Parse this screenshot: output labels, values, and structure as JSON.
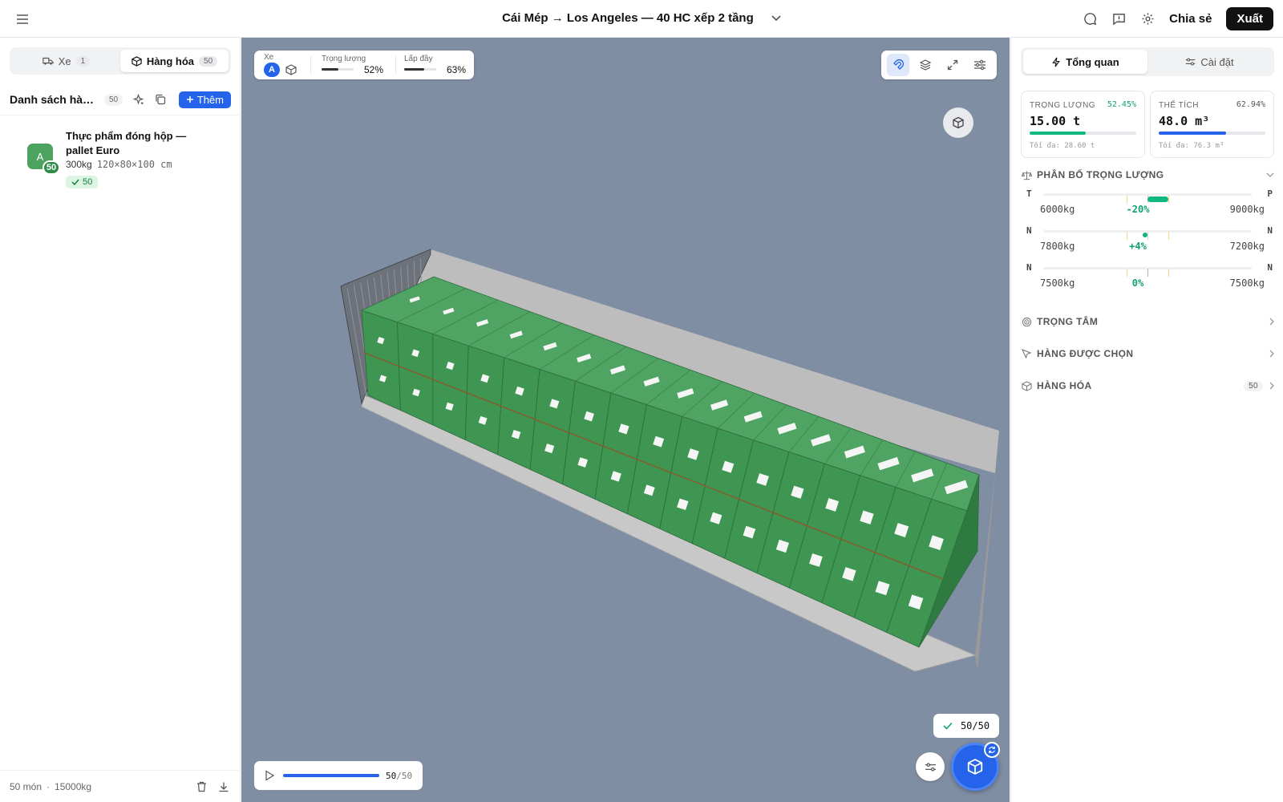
{
  "header": {
    "title": "Cái Mép → Los Angeles — 40 HC xếp 2 tầng",
    "share_label": "Chia sẻ",
    "export_label": "Xuất"
  },
  "left": {
    "tabs": [
      {
        "label": "Xe",
        "count": "1"
      },
      {
        "label": "Hàng hóa",
        "count": "50"
      }
    ],
    "list_title": "Danh sách hàng hóa",
    "list_count": "50",
    "add_label": "Thêm",
    "items": [
      {
        "letter": "A",
        "count": "50",
        "name": "Thực phẩm đóng hộp — pallet Euro",
        "weight": "300kg",
        "dims": "120×80×100 cm",
        "placed": "50"
      }
    ],
    "footer": {
      "items": "50 món",
      "sep": "·",
      "weight": "15000kg"
    }
  },
  "viewport": {
    "stats": {
      "vehicle_label": "Xe",
      "vehicle_letter": "A",
      "weight_label": "Trọng lượng",
      "weight_pct": "52%",
      "weight_fraction": 0.52,
      "fill_label": "Lấp đầy",
      "fill_pct": "63%",
      "fill_fraction": 0.63
    },
    "progress_label": "50/50",
    "playback": {
      "current": "50",
      "total": "/50"
    },
    "colors": {
      "box": "#3f9552",
      "box_top": "#4fa463",
      "box_side": "#2f7a40",
      "background": "#808ea3"
    }
  },
  "right": {
    "tabs": [
      {
        "label": "Tổng quan"
      },
      {
        "label": "Cài đặt"
      }
    ],
    "weight_card": {
      "label": "TRỌNG LƯỢNG",
      "pct": "52.45%",
      "value": "15.00 t",
      "max": "Tối đa: 28.60 t",
      "fraction": 0.5245,
      "color": "#10b981"
    },
    "volume_card": {
      "label": "THỂ TÍCH",
      "pct": "62.94%",
      "value": "48.0 m³",
      "max": "Tối đa: 76.3 m³",
      "fraction": 0.6294,
      "color": "#2563eb"
    },
    "distribution": {
      "title": "PHÂN BỐ TRỌNG LƯỢNG",
      "rows": [
        {
          "left_label": "T",
          "right_label": "P",
          "left_value": "6000kg",
          "mid_value": "-20%",
          "right_value": "9000kg"
        },
        {
          "left_label": "N",
          "right_label": "N",
          "left_value": "7800kg",
          "mid_value": "+4%",
          "right_value": "7200kg"
        },
        {
          "left_label": "N",
          "right_label": "N",
          "left_value": "7500kg",
          "mid_value": "0%",
          "right_value": "7500kg"
        }
      ]
    },
    "sections": [
      {
        "title": "TRỌNG TÂM"
      },
      {
        "title": "HÀNG ĐƯỢC CHỌN"
      },
      {
        "title": "HÀNG HÓA",
        "count": "50"
      }
    ]
  }
}
